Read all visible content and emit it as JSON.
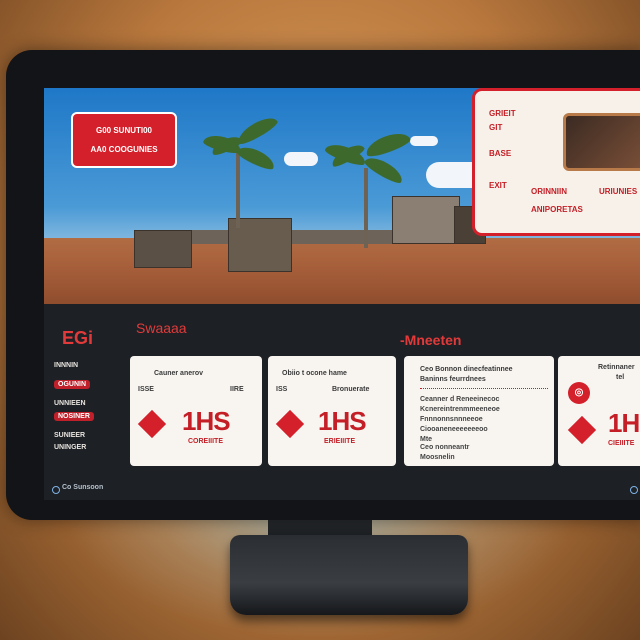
{
  "hero": {
    "badge_line1": "G00 SUNUTI00",
    "badge_line2": "AA0 COOGUNIES"
  },
  "promo": {
    "line1": "GRIEIT",
    "line2": "GIT",
    "line3": "BASE",
    "line4": "EXIT",
    "col_a": "ORINNIIN",
    "col_b": "URIUNIES",
    "col_c": "ANIPORETAS"
  },
  "dashboard": {
    "section_code": "EGi",
    "section_title": "Swaaaa",
    "section_title_right": "-Mneeten"
  },
  "sidebar": {
    "items": [
      {
        "label": "INNNIN"
      },
      {
        "label": "OGUNIN"
      },
      {
        "label": "UNNIEEN"
      },
      {
        "label": "NOSINER"
      },
      {
        "label": "SUNIEER"
      },
      {
        "label": "UNINGER"
      }
    ]
  },
  "cards": [
    {
      "head": "Cauner anerov",
      "sub_left": "ISSE",
      "sub_right": "IIRE",
      "value": "1HS",
      "foot": "COREIIITE"
    },
    {
      "head": "Obiio t ocone hame",
      "sub_left": "ISS",
      "sub_right": "Bronuerate",
      "value": "1HS",
      "foot": "ERIEIIITE"
    },
    {
      "head": "Ceo Bonnon dinecfeatinnee",
      "sub": "Baninns feurrdnees"
    }
  ],
  "list": {
    "rows": [
      "Ceanner d Reneeinecoc",
      "Kcnereintrenmmeeneoe",
      "Fnnnonnsnnneeoe",
      "Ciooaneneeeeeeeoo",
      "Mte",
      "Ceo nonneantr",
      "Moosnelin"
    ]
  },
  "right_card": {
    "head": "Retinnaner",
    "sub": "tel",
    "value": "1H",
    "foot": "CIEIIITE"
  },
  "status": {
    "text": "Co Sunsoon"
  },
  "colors": {
    "accent": "#d4202a",
    "screen_bg": "#1d2126",
    "card_bg": "#f8f5f1"
  }
}
